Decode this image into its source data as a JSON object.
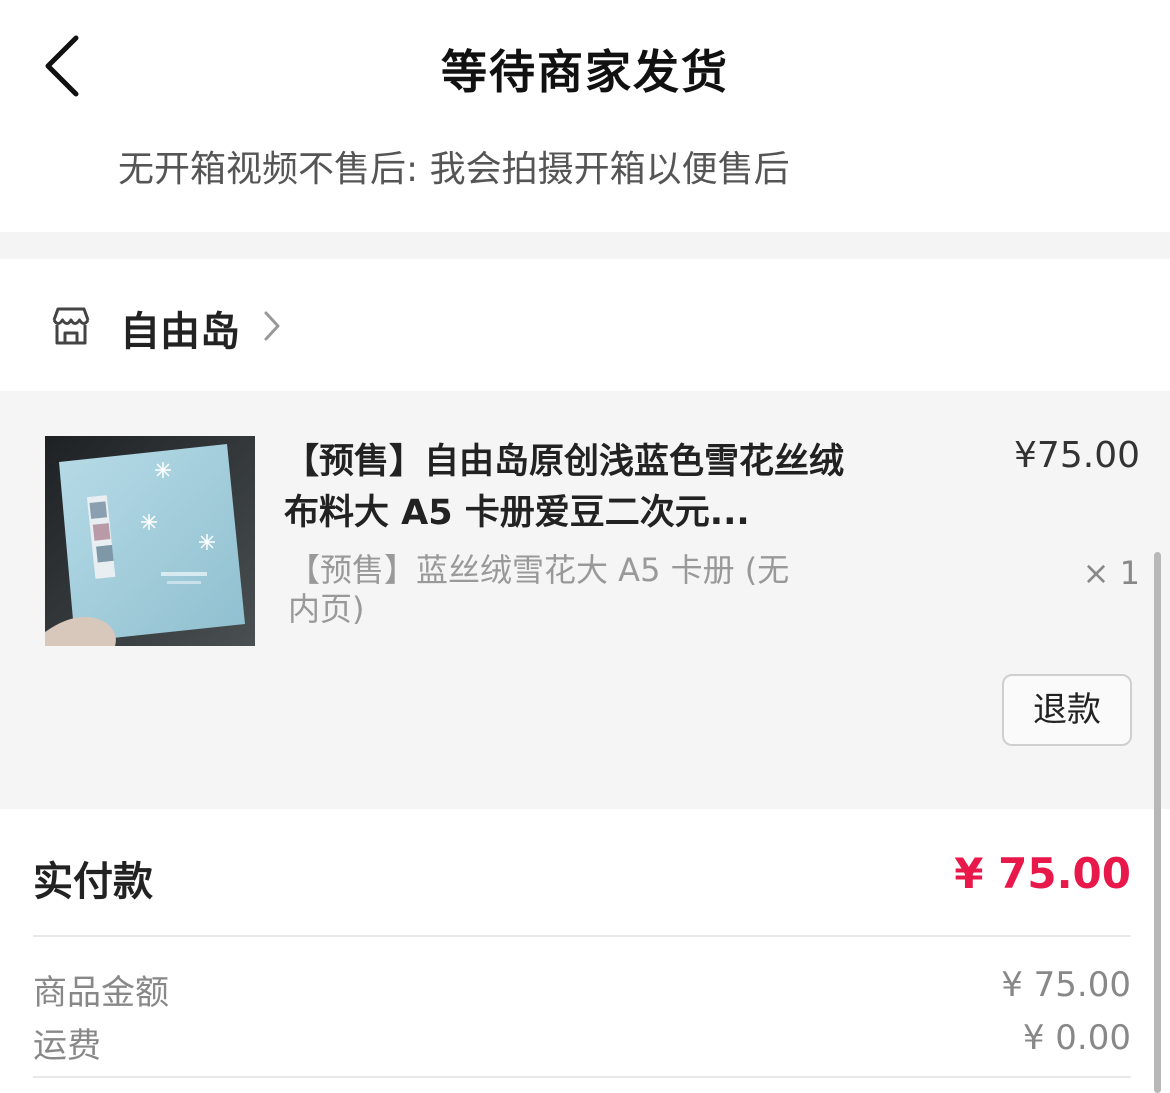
{
  "header": {
    "title": "等待商家发货",
    "back_icon": "chevron-left-icon"
  },
  "notice": "无开箱视频不售后: 我会拍摄开箱以便售后",
  "shop": {
    "name": "自由岛",
    "icon": "store-icon"
  },
  "product": {
    "title": "【预售】自由岛原创浅蓝色雪花丝绒布料大 A5 卡册爱豆二次元...",
    "price": "¥75.00",
    "variant": "【预售】蓝丝绒雪花大 A5 卡册 (无内页)",
    "quantity": "× 1",
    "refund_label": "退款"
  },
  "payment": {
    "total_label": "实付款",
    "total_value": "¥ 75.00",
    "lines": [
      {
        "label": "商品金额",
        "value": "¥ 75.00"
      },
      {
        "label": "运费",
        "value": "¥ 0.00"
      }
    ],
    "accent_color": "#e8184a"
  }
}
